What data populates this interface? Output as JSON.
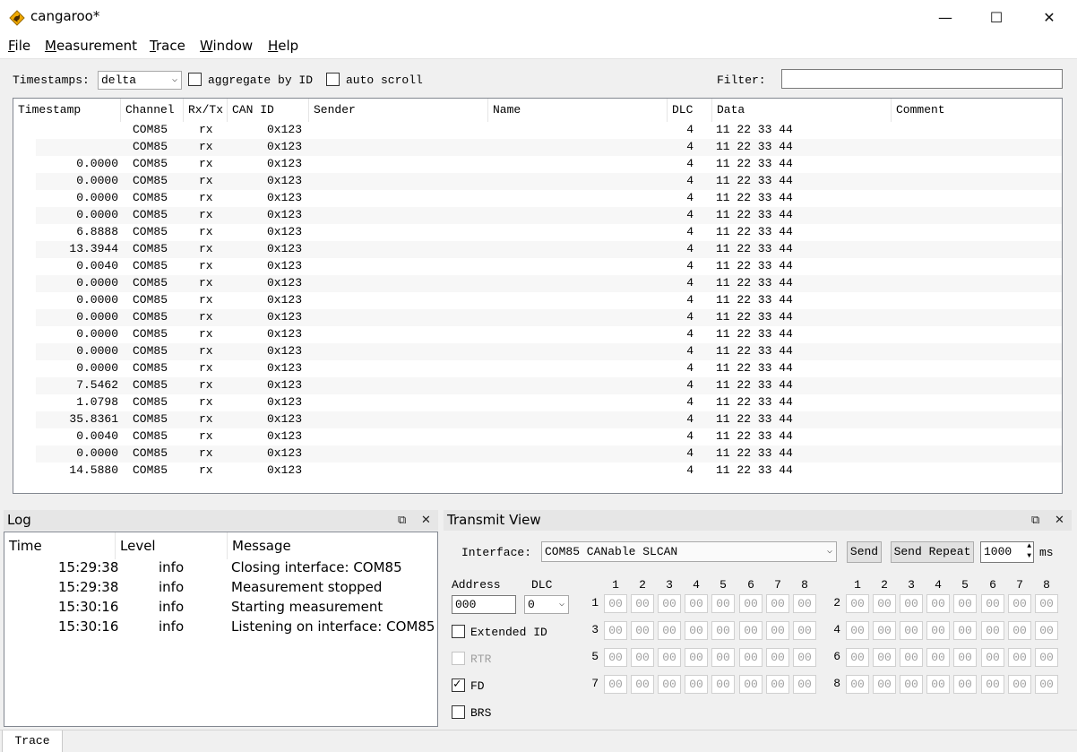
{
  "window": {
    "title": "cangaroo*",
    "minimize_glyph": "—",
    "maximize_glyph": "☐",
    "close_glyph": "✕"
  },
  "menu": [
    {
      "accel": "F",
      "rest": "ile"
    },
    {
      "accel": "M",
      "rest": "easurement"
    },
    {
      "accel": "T",
      "rest": "race"
    },
    {
      "accel": "W",
      "rest": "indow"
    },
    {
      "accel": "H",
      "rest": "elp"
    }
  ],
  "trace_toolbar": {
    "timestamps_label": "Timestamps:",
    "timestamps_value": "delta",
    "aggregate_label": "aggregate by ID",
    "aggregate_checked": false,
    "autoscroll_label": "auto scroll",
    "autoscroll_checked": false,
    "filter_label": "Filter:",
    "filter_value": ""
  },
  "trace_table": {
    "columns": [
      "Timestamp",
      "Channel",
      "Rx/Tx",
      "CAN ID",
      "Sender",
      "Name",
      "DLC",
      "Data",
      "Comment"
    ],
    "rows": [
      {
        "ts": "",
        "ch": "COM85",
        "dir": "rx",
        "id": "0x123",
        "dlc": "4",
        "data": "11 22 33 44"
      },
      {
        "ts": "",
        "ch": "COM85",
        "dir": "rx",
        "id": "0x123",
        "dlc": "4",
        "data": "11 22 33 44"
      },
      {
        "ts": "0.0000",
        "ch": "COM85",
        "dir": "rx",
        "id": "0x123",
        "dlc": "4",
        "data": "11 22 33 44"
      },
      {
        "ts": "0.0000",
        "ch": "COM85",
        "dir": "rx",
        "id": "0x123",
        "dlc": "4",
        "data": "11 22 33 44"
      },
      {
        "ts": "0.0000",
        "ch": "COM85",
        "dir": "rx",
        "id": "0x123",
        "dlc": "4",
        "data": "11 22 33 44"
      },
      {
        "ts": "0.0000",
        "ch": "COM85",
        "dir": "rx",
        "id": "0x123",
        "dlc": "4",
        "data": "11 22 33 44"
      },
      {
        "ts": "6.8888",
        "ch": "COM85",
        "dir": "rx",
        "id": "0x123",
        "dlc": "4",
        "data": "11 22 33 44"
      },
      {
        "ts": "13.3944",
        "ch": "COM85",
        "dir": "rx",
        "id": "0x123",
        "dlc": "4",
        "data": "11 22 33 44"
      },
      {
        "ts": "0.0040",
        "ch": "COM85",
        "dir": "rx",
        "id": "0x123",
        "dlc": "4",
        "data": "11 22 33 44"
      },
      {
        "ts": "0.0000",
        "ch": "COM85",
        "dir": "rx",
        "id": "0x123",
        "dlc": "4",
        "data": "11 22 33 44"
      },
      {
        "ts": "0.0000",
        "ch": "COM85",
        "dir": "rx",
        "id": "0x123",
        "dlc": "4",
        "data": "11 22 33 44"
      },
      {
        "ts": "0.0000",
        "ch": "COM85",
        "dir": "rx",
        "id": "0x123",
        "dlc": "4",
        "data": "11 22 33 44"
      },
      {
        "ts": "0.0000",
        "ch": "COM85",
        "dir": "rx",
        "id": "0x123",
        "dlc": "4",
        "data": "11 22 33 44"
      },
      {
        "ts": "0.0000",
        "ch": "COM85",
        "dir": "rx",
        "id": "0x123",
        "dlc": "4",
        "data": "11 22 33 44"
      },
      {
        "ts": "0.0000",
        "ch": "COM85",
        "dir": "rx",
        "id": "0x123",
        "dlc": "4",
        "data": "11 22 33 44"
      },
      {
        "ts": "7.5462",
        "ch": "COM85",
        "dir": "rx",
        "id": "0x123",
        "dlc": "4",
        "data": "11 22 33 44"
      },
      {
        "ts": "1.0798",
        "ch": "COM85",
        "dir": "rx",
        "id": "0x123",
        "dlc": "4",
        "data": "11 22 33 44"
      },
      {
        "ts": "35.8361",
        "ch": "COM85",
        "dir": "rx",
        "id": "0x123",
        "dlc": "4",
        "data": "11 22 33 44"
      },
      {
        "ts": "0.0040",
        "ch": "COM85",
        "dir": "rx",
        "id": "0x123",
        "dlc": "4",
        "data": "11 22 33 44"
      },
      {
        "ts": "0.0000",
        "ch": "COM85",
        "dir": "rx",
        "id": "0x123",
        "dlc": "4",
        "data": "11 22 33 44"
      },
      {
        "ts": "14.5880",
        "ch": "COM85",
        "dir": "rx",
        "id": "0x123",
        "dlc": "4",
        "data": "11 22 33 44"
      }
    ]
  },
  "log": {
    "title": "Log",
    "columns": [
      "Time",
      "Level",
      "Message"
    ],
    "rows": [
      {
        "time": "15:29:38",
        "level": "info",
        "message": "Closing interface: COM85"
      },
      {
        "time": "15:29:38",
        "level": "info",
        "message": "Measurement stopped"
      },
      {
        "time": "15:30:16",
        "level": "info",
        "message": "Starting measurement"
      },
      {
        "time": "15:30:16",
        "level": "info",
        "message": "Listening on interface: COM85"
      }
    ]
  },
  "transmit": {
    "title": "Transmit View",
    "interface_label": "Interface:",
    "interface_value": "COM85 CANable SLCAN",
    "send_label": "Send",
    "send_repeat_label": "Send Repeat",
    "repeat_value": "1000",
    "ms_label": "ms",
    "address_label": "Address",
    "address_value": "000",
    "dlc_label": "DLC",
    "dlc_value": "0",
    "extended_id_label": "Extended ID",
    "extended_id_checked": false,
    "rtr_label": "RTR",
    "rtr_checked": false,
    "fd_label": "FD",
    "fd_checked": true,
    "brs_label": "BRS",
    "brs_checked": false,
    "col_numbers": [
      "1",
      "2",
      "3",
      "4",
      "5",
      "6",
      "7",
      "8"
    ],
    "left_rows": [
      "1",
      "3",
      "5",
      "7"
    ],
    "right_rows": [
      "2",
      "4",
      "6",
      "8"
    ],
    "byte_placeholder": "00"
  },
  "statusbar": {
    "tab_label": "Trace"
  },
  "colors": {
    "accent": "#f0a800",
    "selection": "#cce8ff",
    "panel_title": "#e6e6e6"
  }
}
